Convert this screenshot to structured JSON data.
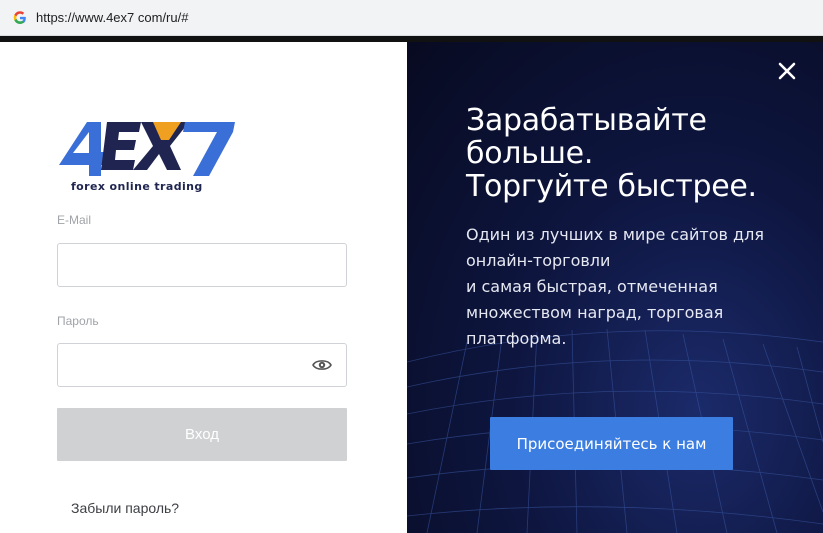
{
  "browser": {
    "url": "https://www.4ex7 com/ru/#",
    "favicon": "google-g-icon"
  },
  "login_form": {
    "logo": {
      "wordmark": "4EX7",
      "tagline": "forex online trading",
      "colors": {
        "blue": "#3b6fd8",
        "navy": "#1f2550",
        "orange": "#f0a020"
      }
    },
    "email_label": "E-Mail",
    "email_value": "",
    "password_label": "Пароль",
    "password_value": "",
    "show_password_icon": "eye-icon",
    "login_button": "Вход",
    "forgot_password": "Забыли пароль?"
  },
  "promo": {
    "close_icon": "close-icon",
    "headline": [
      "Зарабатывайте",
      "больше.",
      "Торгуйте быстрее."
    ],
    "description": [
      "Один из лучших в мире сайтов для",
      "онлайн-торговли",
      "и самая быстрая, отмеченная",
      "множеством наград, торговая",
      "платформа."
    ],
    "join_button": "Присоединяйтесь к нам",
    "colors": {
      "background": "#0e1640",
      "button": "#3b7de0"
    }
  }
}
